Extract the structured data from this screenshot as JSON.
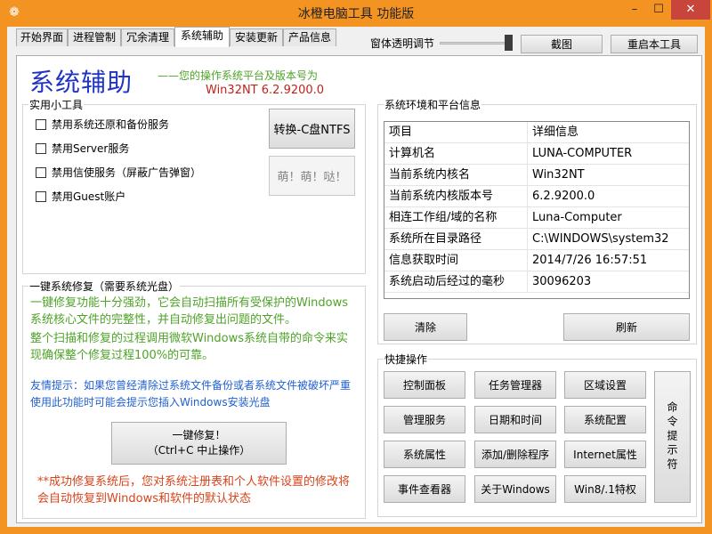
{
  "window": {
    "title": "冰橙电脑工具 功能版",
    "icon": "gear-icon",
    "controls": {
      "minimize": "–",
      "maximize": "☐",
      "close": "✕"
    },
    "colors": {
      "frame": "#f39321",
      "close": "#c7453b"
    }
  },
  "tabs": [
    "开始界面",
    "进程管制",
    "冗余清理",
    "系统辅助",
    "安装更新",
    "产品信息"
  ],
  "active_tab": "系统辅助",
  "top_controls": {
    "transparency_label": "窗体透明调节",
    "transparency_level": 1.0,
    "screenshot_button": "截图",
    "restart_button": "重启本工具"
  },
  "header": {
    "title": "系统辅助",
    "os_hint": "——您的操作系统平台及版本号为",
    "os_version": "Win32NT  6.2.9200.0",
    "colors": {
      "title": "#1f34c2",
      "hint": "#4fa329",
      "version": "#c3201a"
    }
  },
  "tools": {
    "group_title": "实用小工具",
    "checkboxes": [
      "禁用系统还原和备份服务",
      "禁用Server服务",
      "禁用信使服务（屏蔽广告弹窗）",
      "禁用Guest账户"
    ],
    "convert_button": "转换-C盘NTFS",
    "meng_button": "萌！萌！哒！"
  },
  "repair": {
    "group_title": "一键系统修复（需要系统光盘）",
    "desc1": "一键修复功能十分强劲，它会自动扫描所有受保护的Windows系统核心文件的完整性，并自动修复出问题的文件。",
    "desc2": "整个扫描和修复的过程调用微软Windows系统自带的命令来实现确保整个修复过程100%的可靠。",
    "tip": "友情提示：如果您曾经清除过系统文件备份或者系统文件被破坏严重使用此功能时可能会提示您插入Windows安装光盘",
    "button_line1": "一键修复！",
    "button_line2": "（Ctrl+C 中止操作）",
    "warning": "**成功修复系统后，您对系统注册表和个人软件设置的修改将会自动恢复到Windows和软件的默认状态"
  },
  "sysinfo": {
    "group_title": "系统环境和平台信息",
    "headers": [
      "项目",
      "详细信息"
    ],
    "rows": [
      [
        "计算机名",
        "LUNA-COMPUTER"
      ],
      [
        "当前系统内核名",
        "Win32NT"
      ],
      [
        "当前系统内核版本号",
        "6.2.9200.0"
      ],
      [
        "相连工作组/域的名称",
        "Luna-Computer"
      ],
      [
        "系统所在目录路径",
        "C:\\WINDOWS\\system32"
      ],
      [
        "信息获取时间",
        "2014/7/26 16:57:51"
      ],
      [
        "系统启动后经过的毫秒",
        "30096203"
      ]
    ],
    "clear_button": "清除",
    "refresh_button": "刷新"
  },
  "quick": {
    "group_title": "快捷操作",
    "buttons": [
      [
        "控制面板",
        "任务管理器",
        "区域设置"
      ],
      [
        "管理服务",
        "日期和时间",
        "系统配置"
      ],
      [
        "系统属性",
        "添加/删除程序",
        "Internet属性"
      ],
      [
        "事件查看器",
        "关于Windows",
        "Win8/.1特权"
      ]
    ],
    "cmd_button": "命令提示符"
  }
}
